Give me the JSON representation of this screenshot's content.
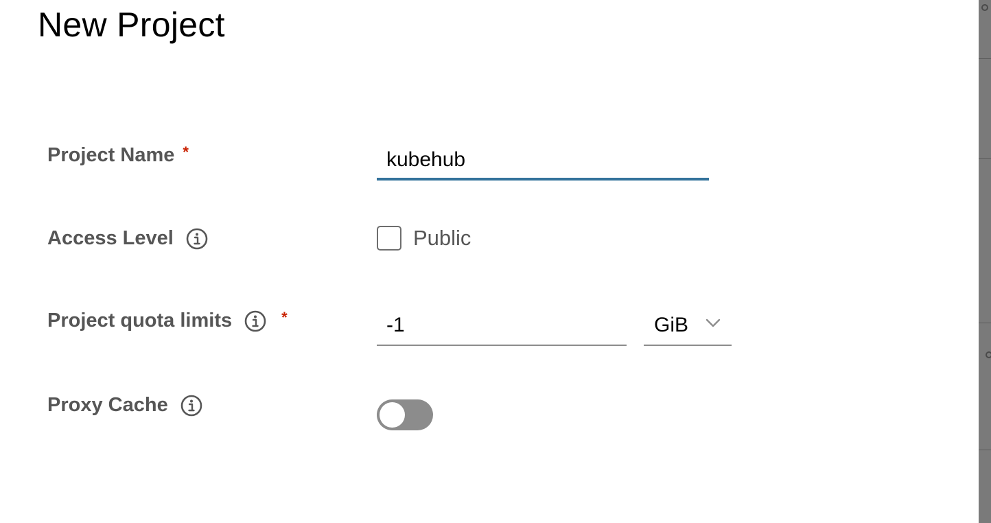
{
  "dialog": {
    "title": "New Project"
  },
  "form": {
    "project_name": {
      "label": "Project Name",
      "required_mark": "*",
      "value": "kubehub"
    },
    "access_level": {
      "label": "Access Level",
      "info_icon": "info-circle-icon",
      "checkbox_label": "Public",
      "checked": false
    },
    "quota": {
      "label": "Project quota limits",
      "info_icon": "info-circle-icon",
      "required_mark": "*",
      "value": "-1",
      "unit_selected": "GiB"
    },
    "proxy_cache": {
      "label": "Proxy Cache",
      "info_icon": "info-circle-icon",
      "enabled": false
    }
  },
  "colors": {
    "active_input_underline": "#33729b",
    "required_mark": "#c92100",
    "label_text": "#565656",
    "toggle_off": "#8c8c8c"
  }
}
